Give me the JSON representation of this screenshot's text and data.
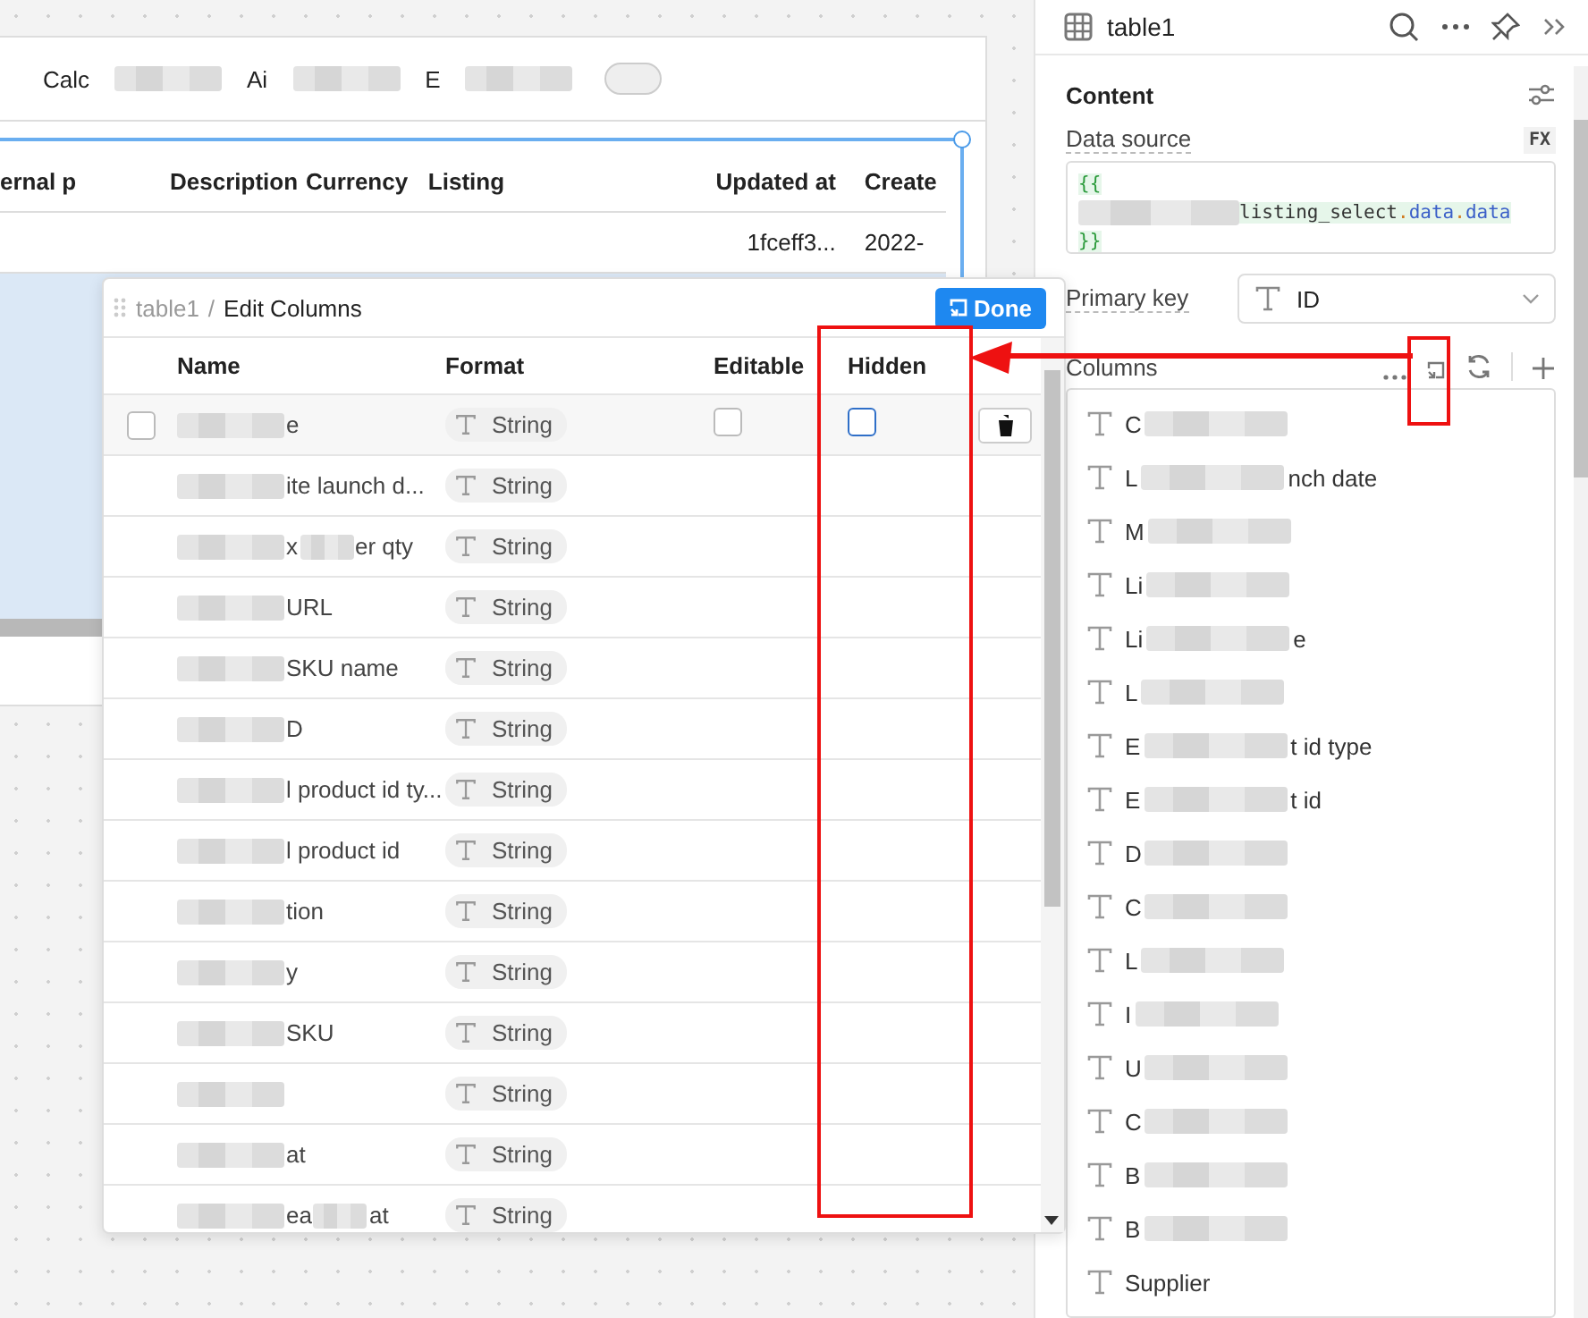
{
  "toolbar": {
    "items": [
      "Calc",
      "Ai",
      "E"
    ],
    "toggle_on": false
  },
  "table": {
    "columns": [
      "ernal p",
      "Description",
      "Currency",
      "Listing",
      "Updated at",
      "Create"
    ],
    "rows": [
      [
        null,
        null,
        null,
        null,
        "1fceff3...",
        "2022-"
      ]
    ]
  },
  "dialog": {
    "breadcrumb": "table1",
    "separator": "/",
    "title": "Edit Columns",
    "done": "Done",
    "columns": [
      "Name",
      "Format",
      "Editable",
      "Hidden"
    ],
    "rows": [
      {
        "tail": "e",
        "format": "String",
        "hovered": true,
        "editable": false,
        "hidden": false
      },
      {
        "tail": "ite launch d...",
        "format": "String",
        "hovered": false
      },
      {
        "head": "x",
        "tail": "er qty",
        "format": "String",
        "hovered": false
      },
      {
        "tail": "URL",
        "format": "String",
        "hovered": false
      },
      {
        "tail": "SKU name",
        "format": "String",
        "hovered": false
      },
      {
        "tail": "D",
        "format": "String",
        "hovered": false
      },
      {
        "tail": "l product id ty...",
        "format": "String",
        "hovered": false
      },
      {
        "tail": "l product id",
        "format": "String",
        "hovered": false
      },
      {
        "tail": "tion",
        "format": "String",
        "hovered": false
      },
      {
        "tail": "y",
        "format": "String",
        "hovered": false
      },
      {
        "tail": "SKU",
        "format": "String",
        "hovered": false
      },
      {
        "format": "String",
        "hovered": false
      },
      {
        "tail": "at",
        "format": "String",
        "hovered": false
      },
      {
        "head": "ea",
        "tail": "at",
        "format": "String",
        "hovered": false
      }
    ]
  },
  "panel": {
    "title": "table1",
    "section": "Content",
    "data_source_label": "Data source",
    "fx": "FX",
    "code": {
      "open": "{{",
      "object": "listing_select",
      "path": [
        ".data",
        ".data"
      ],
      "close": "}}"
    },
    "primary_key_label": "Primary key",
    "primary_key": "ID",
    "columns_label": "Columns",
    "columns": [
      {
        "head": "C",
        "redacted": true
      },
      {
        "head": "L",
        "tail": "nch date",
        "redacted": true
      },
      {
        "head": "M",
        "redacted": true
      },
      {
        "head": "Li",
        "redacted": true
      },
      {
        "head": "Li",
        "tail": "e",
        "redacted": true
      },
      {
        "head": "L",
        "redacted": true
      },
      {
        "head": "E",
        "tail": "t id type",
        "redacted": true
      },
      {
        "head": "E",
        "tail": "t id",
        "redacted": true
      },
      {
        "head": "D",
        "redacted": true
      },
      {
        "head": "C",
        "redacted": true
      },
      {
        "head": "L",
        "redacted": true
      },
      {
        "head": "I",
        "redacted": true
      },
      {
        "head": "U",
        "redacted": true
      },
      {
        "head": "C",
        "redacted": true
      },
      {
        "head": "B",
        "redacted": true
      },
      {
        "head": "B",
        "redacted": true
      },
      {
        "head": "Supplier",
        "redacted": false
      }
    ]
  }
}
